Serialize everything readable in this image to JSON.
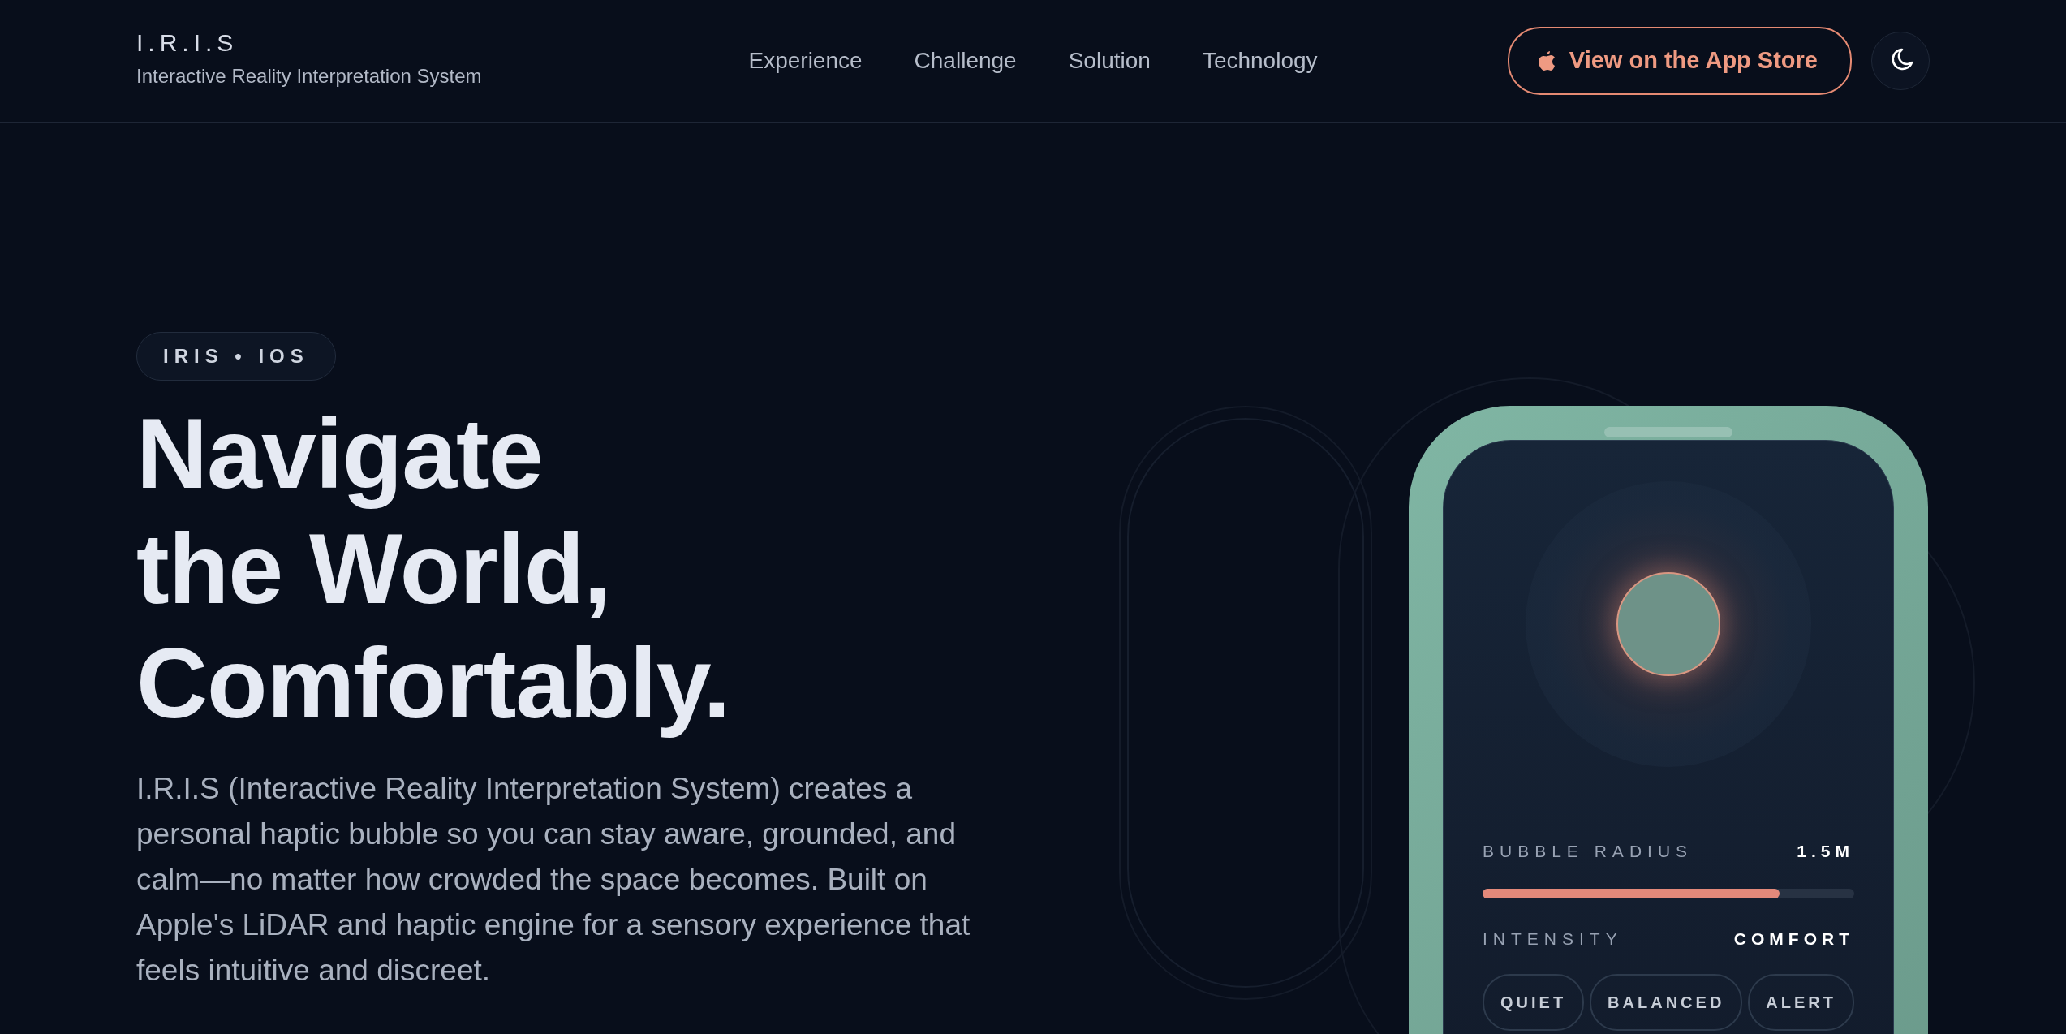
{
  "header": {
    "logo": "I.R.I.S",
    "tagline": "Interactive Reality Interpretation System",
    "nav": [
      {
        "label": "Experience"
      },
      {
        "label": "Challenge"
      },
      {
        "label": "Solution"
      },
      {
        "label": "Technology"
      }
    ],
    "app_store_button": "View on the App Store"
  },
  "hero": {
    "badge": "IRIS • IOS",
    "heading_lines": [
      "Navigate",
      "the World,",
      "Comfortably."
    ],
    "description": "I.R.I.S (Interactive Reality Interpretation System) creates a personal haptic bubble so you can stay aware, grounded, and calm—no matter how crowded the space becomes. Built on Apple's LiDAR and haptic engine for a sensory experience that feels intuitive and discreet."
  },
  "phone": {
    "bubble_radius": {
      "label": "BUBBLE RADIUS",
      "value": "1.5M",
      "level": 0.8
    },
    "intensity": {
      "label": "INTENSITY",
      "value": "COMFORT"
    },
    "modes": [
      {
        "label": "QUIET",
        "selected": false
      },
      {
        "label": "BALANCED",
        "selected": false
      },
      {
        "label": "ALERT",
        "selected": false
      }
    ]
  }
}
